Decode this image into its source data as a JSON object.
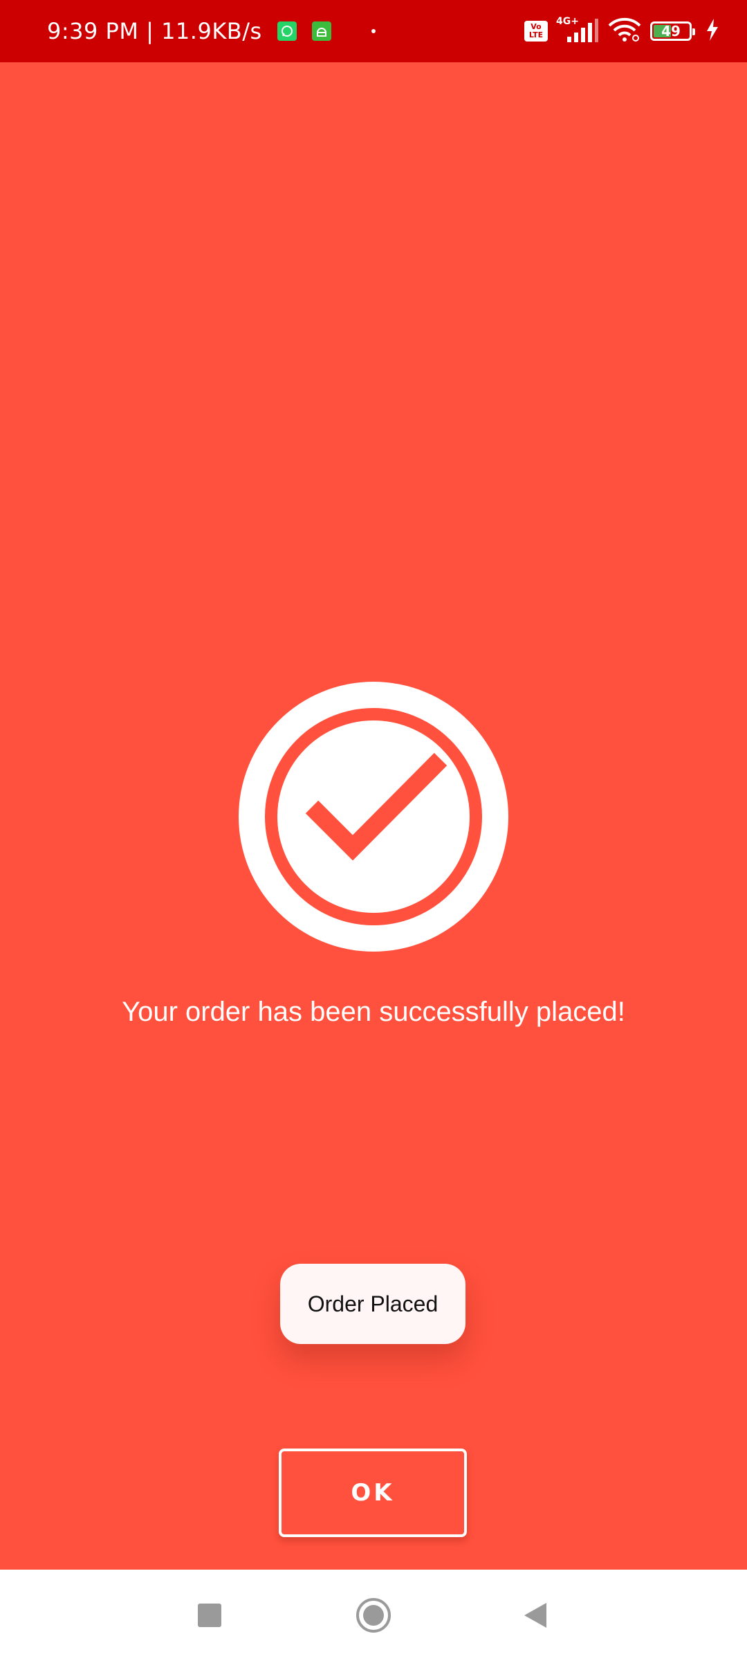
{
  "status_bar": {
    "time_speed": "9:39 PM | 11.9KB/s",
    "volte_top": "Vo",
    "volte_bottom": "LTE",
    "network": "4G+",
    "battery_level": "49",
    "battery_fraction": 0.49
  },
  "order": {
    "message": "Your order has been successfully placed!",
    "toast": "Order Placed",
    "ok_label": "OK"
  },
  "colors": {
    "background": "#FF513D",
    "status_bar": "#CC0000",
    "white": "#FFFFFF"
  }
}
